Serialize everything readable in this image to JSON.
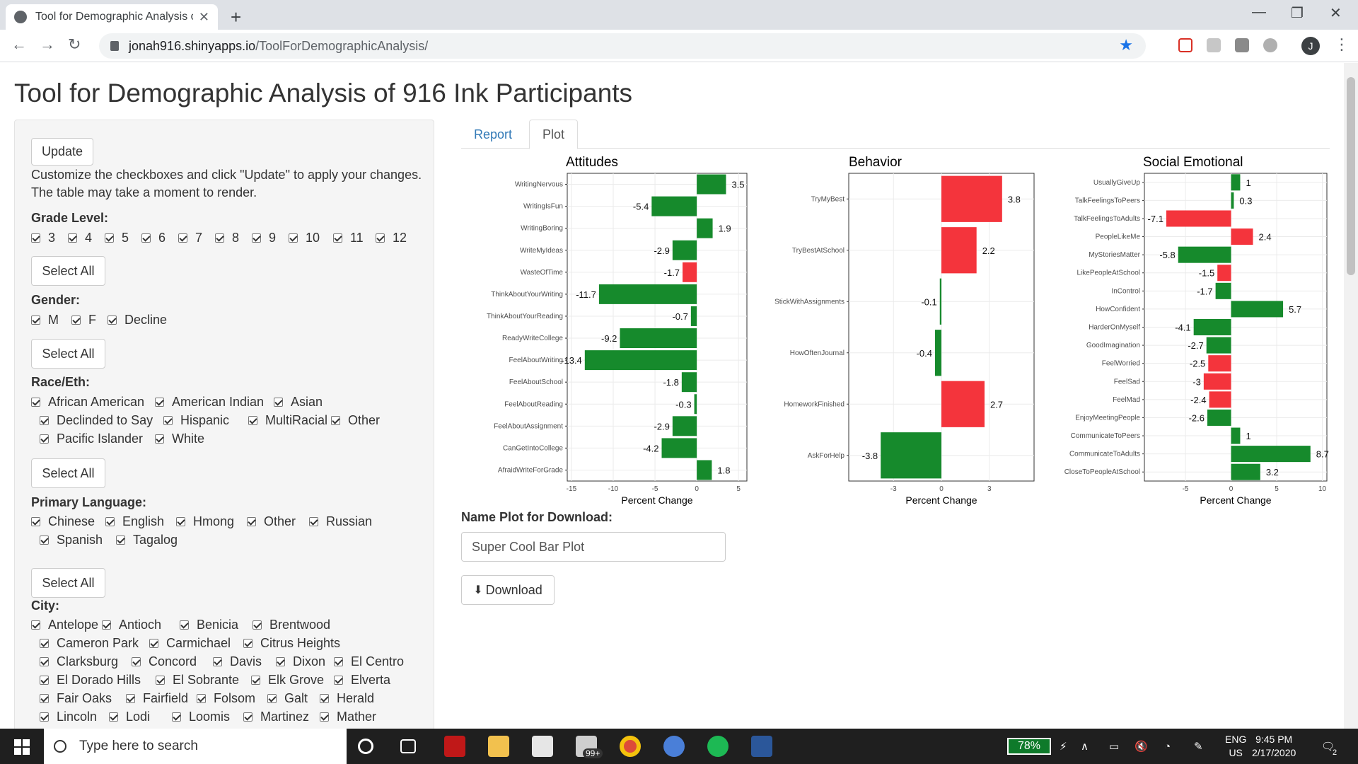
{
  "browser": {
    "tab_title": "Tool for Demographic Analysis of",
    "url_host": "jonah916.shinyapps.io",
    "url_path": "/ToolForDemographicAnalysis/",
    "profile_initial": "J"
  },
  "page": {
    "title": "Tool for Demographic Analysis of 916 Ink Participants"
  },
  "sidebar": {
    "update_label": "Update",
    "help_text": "Customize the checkboxes and click \"Update\" to apply your changes. The table may take a moment to render.",
    "select_all_label": "Select All",
    "grade": {
      "label": "Grade Level:",
      "options": [
        "3",
        "4",
        "5",
        "6",
        "7",
        "8",
        "9",
        "10",
        "11",
        "12"
      ]
    },
    "gender": {
      "label": "Gender:",
      "options": [
        "M",
        "F",
        "Decline"
      ]
    },
    "race": {
      "label": "Race/Eth:",
      "options": [
        "African American",
        "American Indian",
        "Asian",
        "Declinded to Say",
        "Hispanic",
        "MultiRacial",
        "Other",
        "Pacific Islander",
        "White"
      ]
    },
    "language": {
      "label": "Primary Language:",
      "options": [
        "Chinese",
        "English",
        "Hmong",
        "Other",
        "Russian",
        "Spanish",
        "Tagalog"
      ]
    },
    "city": {
      "label": "City:",
      "options": [
        "Antelope",
        "Antioch",
        "Benicia",
        "Brentwood",
        "Cameron Park",
        "Carmichael",
        "Citrus Heights",
        "Clarksburg",
        "Concord",
        "Davis",
        "Dixon",
        "El Centro",
        "El Dorado Hills",
        "El Sobrante",
        "Elk Grove",
        "Elverta",
        "Fair Oaks",
        "Fairfield",
        "Folsom",
        "Galt",
        "Herald",
        "Lincoln",
        "Lodi",
        "Loomis",
        "Martinez",
        "Mather"
      ]
    }
  },
  "tabs": {
    "report": "Report",
    "plot": "Plot"
  },
  "download": {
    "label": "Name Plot for Download:",
    "input_value": "Super Cool Bar Plot",
    "button_label": "Download"
  },
  "taskbar": {
    "search_placeholder": "Type here to search",
    "battery": "78%",
    "lang1": "ENG",
    "lang2": "US",
    "time": "9:45 PM",
    "date": "2/17/2020",
    "mail_badge": "99+",
    "notif_count": "2"
  },
  "colors": {
    "positive_good": "#168a2c",
    "negative_bad": "#f4343c"
  },
  "chart_data": [
    {
      "type": "bar",
      "orientation": "horizontal",
      "title": "Attitudes",
      "xlabel": "Percent Change",
      "xlim": [
        -15.5,
        6
      ],
      "xticks": [
        -15,
        -10,
        -5,
        0,
        5
      ],
      "categories": [
        "WritingNervous",
        "WritingIsFun",
        "WritingBoring",
        "WriteMyIdeas",
        "WasteOfTime",
        "ThinkAboutYourWriting",
        "ThinkAboutYourReading",
        "ReadyWriteCollege",
        "FeelAboutWriting",
        "FeelAboutSchool",
        "FeelAboutReading",
        "FeelAboutAssignment",
        "CanGetIntoCollege",
        "AfraidWriteForGrade"
      ],
      "values": [
        3.5,
        -5.4,
        1.9,
        -2.9,
        -1.7,
        -11.7,
        -0.7,
        -9.2,
        -13.4,
        -1.8,
        -0.3,
        -2.9,
        -4.2,
        1.8
      ],
      "colors": [
        "g",
        "g",
        "g",
        "g",
        "r",
        "g",
        "g",
        "g",
        "g",
        "g",
        "g",
        "g",
        "g",
        "g"
      ]
    },
    {
      "type": "bar",
      "orientation": "horizontal",
      "title": "Behavior",
      "xlabel": "Percent Change",
      "xlim": [
        -5.8,
        5.8
      ],
      "xticks": [
        -3,
        0,
        3
      ],
      "categories": [
        "TryMyBest",
        "TryBestAtSchool",
        "StickWithAssignments",
        "HowOftenJournal",
        "HomeworkFinished",
        "AskForHelp"
      ],
      "values": [
        3.8,
        2.2,
        -0.1,
        -0.4,
        2.7,
        -3.8
      ],
      "colors": [
        "r",
        "r",
        "g",
        "g",
        "r",
        "g"
      ]
    },
    {
      "type": "bar",
      "orientation": "horizontal",
      "title": "Social Emotional",
      "xlabel": "Percent Change",
      "xlim": [
        -9.5,
        10.5
      ],
      "xticks": [
        -5,
        0,
        5,
        10
      ],
      "categories": [
        "UsuallyGiveUp",
        "TalkFeelingsToPeers",
        "TalkFeelingsToAdults",
        "PeopleLikeMe",
        "MyStoriesMatter",
        "LikePeopleAtSchool",
        "InControl",
        "HowConfident",
        "HarderOnMyself",
        "GoodImagination",
        "FeelWorried",
        "FeelSad",
        "FeelMad",
        "EnjoyMeetingPeople",
        "CommunicateToPeers",
        "CommunicateToAdults",
        "CloseToPeopleAtSchool"
      ],
      "values": [
        1,
        0.3,
        -7.1,
        2.4,
        -5.8,
        -1.5,
        -1.7,
        5.7,
        -4.1,
        -2.7,
        -2.5,
        -3,
        -2.4,
        -2.6,
        1,
        8.7,
        3.2
      ],
      "colors": [
        "g",
        "g",
        "r",
        "r",
        "g",
        "r",
        "g",
        "g",
        "g",
        "g",
        "r",
        "r",
        "r",
        "g",
        "g",
        "g",
        "g"
      ]
    }
  ]
}
